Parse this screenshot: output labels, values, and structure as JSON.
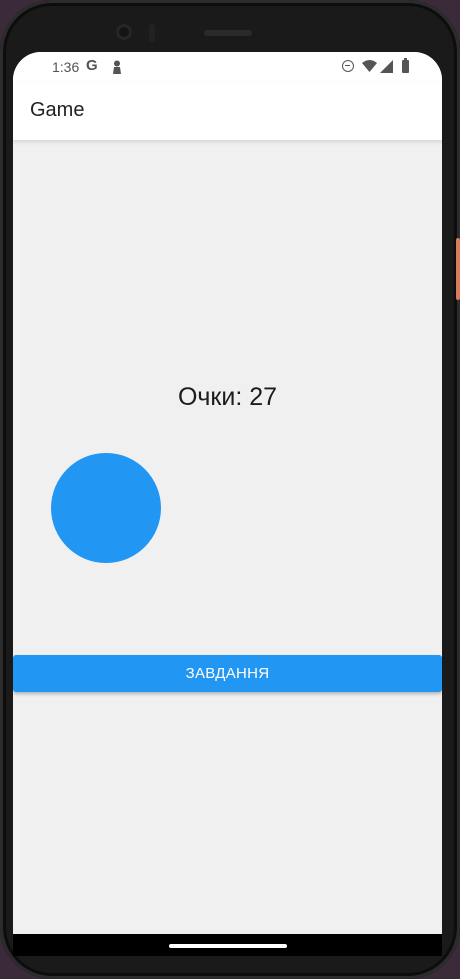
{
  "status_bar": {
    "time": "1:36",
    "icons": [
      "google-icon",
      "person-icon",
      "do-not-disturb-icon",
      "wifi-icon",
      "signal-icon",
      "battery-icon"
    ],
    "google_glyph": "G"
  },
  "app_bar": {
    "title": "Game"
  },
  "game": {
    "score_text": "Очки: 27",
    "target_color": "#2196f3"
  },
  "actions": {
    "task_button_label": "ЗАВДАННЯ"
  },
  "colors": {
    "accent": "#2196f3",
    "background": "#f0f0f1",
    "app_bar": "#ffffff"
  }
}
